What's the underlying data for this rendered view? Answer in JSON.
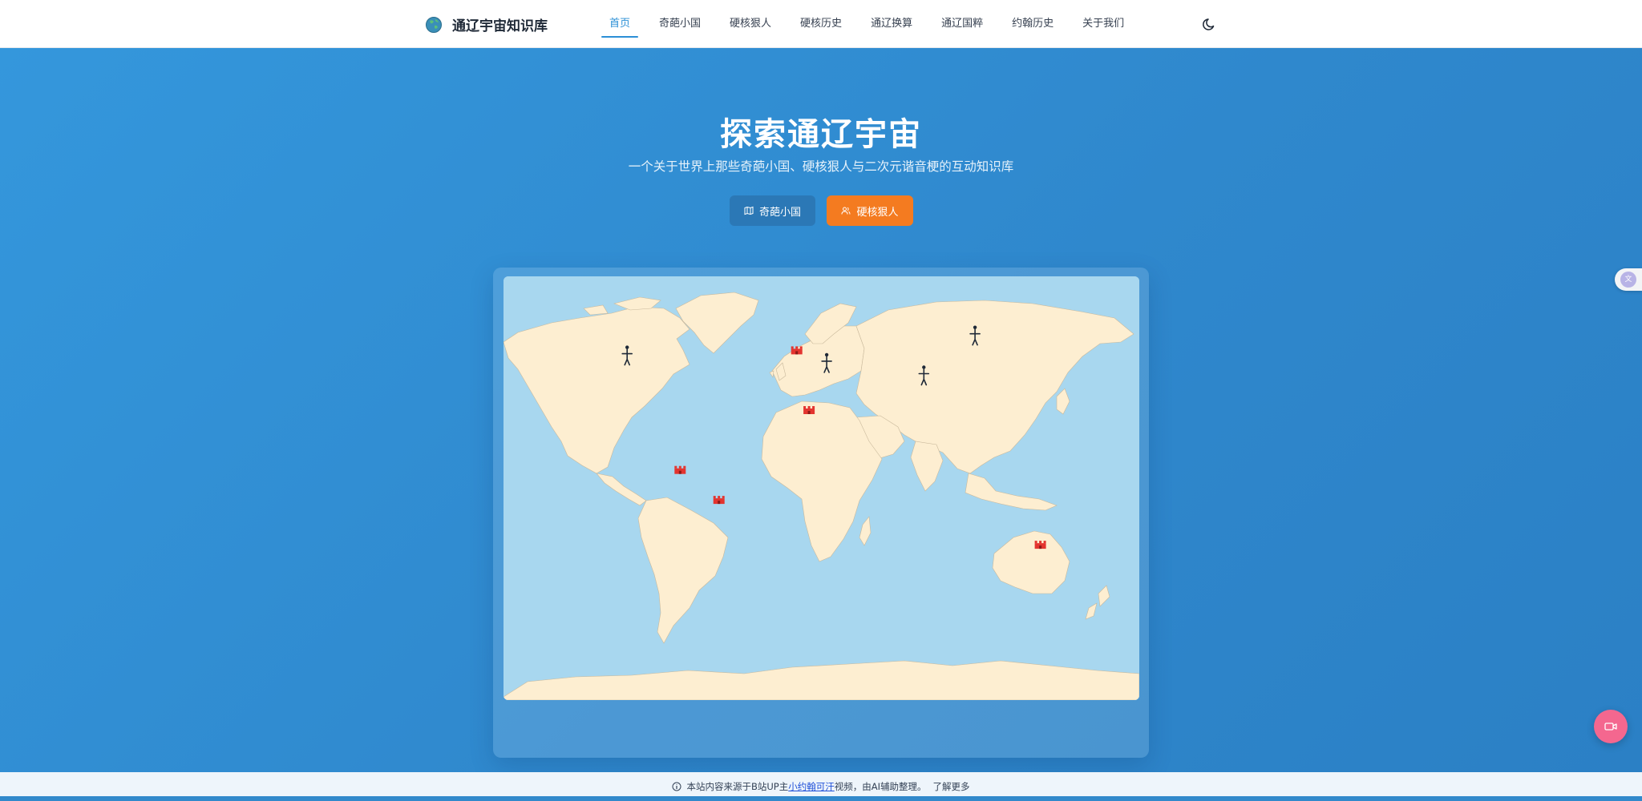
{
  "header": {
    "logo_text": "通辽宇宙知识库",
    "nav": [
      "首页",
      "奇葩小国",
      "硬核狠人",
      "硬核历史",
      "通辽换算",
      "通辽国粹",
      "约翰历史",
      "关于我们"
    ],
    "active_index": 0
  },
  "hero": {
    "title": "探索通辽宇宙",
    "subtitle": "一个关于世界上那些奇葩小国、硬核狠人与二次元谐音梗的互动知识库",
    "button_countries": "奇葩小国",
    "button_people": "硬核狠人"
  },
  "map": {
    "markers": [
      {
        "type": "person-icon",
        "lon": -100,
        "lat": 50
      },
      {
        "type": "person-icon",
        "lon": 13,
        "lat": 47
      },
      {
        "type": "person-icon",
        "lon": 68,
        "lat": 42
      },
      {
        "type": "person-icon",
        "lon": 97,
        "lat": 58
      },
      {
        "type": "castle-icon",
        "lon": -4,
        "lat": 52
      },
      {
        "type": "castle-icon",
        "lon": 3,
        "lat": 28
      },
      {
        "type": "castle-icon",
        "lon": -70,
        "lat": 4
      },
      {
        "type": "castle-icon",
        "lon": -48,
        "lat": -8
      },
      {
        "type": "castle-icon",
        "lon": 134,
        "lat": -26
      }
    ]
  },
  "footer": {
    "prefix": "本站内容来源于B站UP主",
    "link": "小约翰可汗",
    "suffix": "视频，由AI辅助整理。",
    "more": "了解更多"
  },
  "colors": {
    "accent": "#2b8fd6",
    "orange": "#f47b20",
    "hero": "#3189cb",
    "ocean": "#a8d7ef",
    "land": "#fdeed1"
  }
}
